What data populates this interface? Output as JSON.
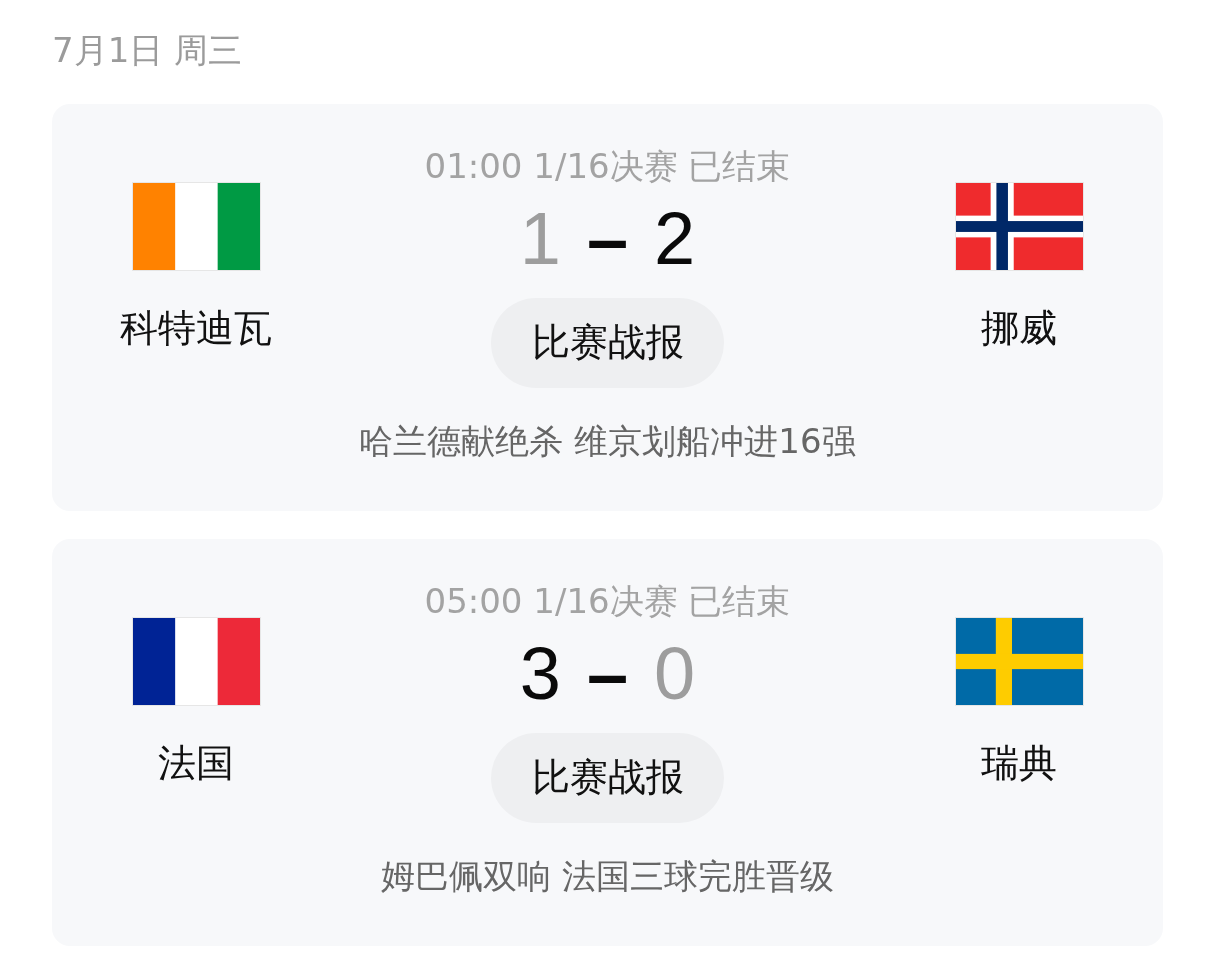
{
  "date_header": "7月1日 周三",
  "matches": [
    {
      "meta": "01:00 1/16决赛 已结束",
      "home": {
        "name": "科特迪瓦",
        "flag": {
          "kind": "tricolor",
          "layers": [
            {
              "color": "#ff8200"
            },
            {
              "color": "#ffffff"
            },
            {
              "color": "#009a44"
            }
          ]
        }
      },
      "away": {
        "name": "挪威",
        "flag": {
          "kind": "cross",
          "layers": [
            {
              "color": "#ef2b2d"
            },
            {
              "color": "#ffffff"
            },
            {
              "color": "#002868"
            }
          ]
        }
      },
      "score": {
        "home": "1",
        "separator": "–",
        "away": "2",
        "home_won": false,
        "away_won": true
      },
      "report_button": "比赛战报",
      "headline": "哈兰德献绝杀 维京划船冲进16强"
    },
    {
      "meta": "05:00 1/16决赛 已结束",
      "home": {
        "name": "法国",
        "flag": {
          "kind": "tricolor",
          "layers": [
            {
              "color": "#002395"
            },
            {
              "color": "#ffffff"
            },
            {
              "color": "#ed2939"
            }
          ]
        }
      },
      "away": {
        "name": "瑞典",
        "flag": {
          "kind": "cross",
          "layers": [
            {
              "color": "#006aa7"
            },
            {
              "color": "#fecc00"
            }
          ]
        }
      },
      "score": {
        "home": "3",
        "separator": "–",
        "away": "0",
        "home_won": true,
        "away_won": false
      },
      "report_button": "比赛战报",
      "headline": "姆巴佩双响 法国三球完胜晋级"
    }
  ]
}
